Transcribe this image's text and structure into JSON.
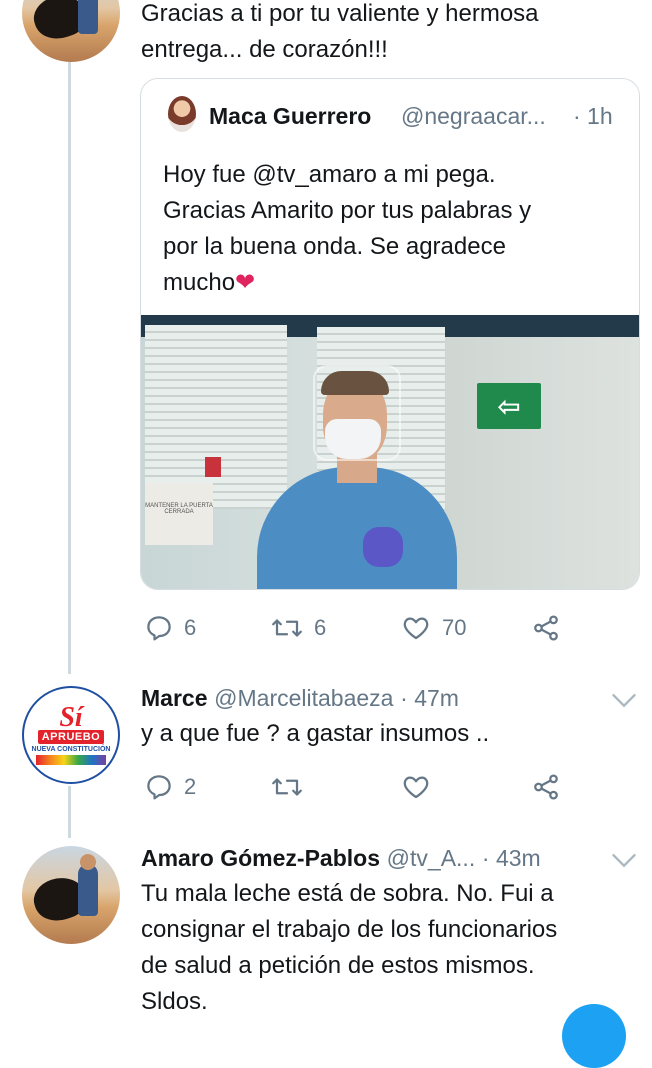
{
  "reply1": {
    "text_lines": [
      "Gracias a ti por tu valiente y hermosa",
      "entrega... de corazón!!!"
    ]
  },
  "quoted_tweet": {
    "name": "Maca Guerrero",
    "handle": "@negraacar...",
    "time": "· 1h",
    "text_lines": [
      "Hoy fue @tv_amaro a mi pega.",
      "Gracias Amarito por tus palabras y",
      "por la buena onda. Se agradece",
      "mucho"
    ],
    "emoji": "❤",
    "photo": {
      "exit_sign": "⇦",
      "door_note": "MANTENER LA PUERTA CERRADA"
    }
  },
  "tweet1_actions": {
    "replies": "6",
    "retweets": "6",
    "likes": "70"
  },
  "tweet2": {
    "name": "Marce",
    "handle": "@Marcelitabaeza",
    "time": "· 47m",
    "text": "y a que fue ?  a gastar insumos ..",
    "avatar": {
      "si": "Sí",
      "word": "APRUEBO",
      "sub": "NUEVA CONSTITUCIÓN"
    },
    "actions": {
      "replies": "2",
      "retweets": "",
      "likes": ""
    }
  },
  "tweet3": {
    "name": "Amaro Gómez-Pablos",
    "handle": "@tv_A...",
    "time": "· 43m",
    "text_lines": [
      "Tu mala leche está de sobra. No. Fui a",
      "consignar el trabajo de los funcionarios",
      "de salud a petición de estos mismos.",
      "Sldos."
    ]
  },
  "colors": {
    "text": "#14171a",
    "muted": "#657786",
    "border": "#d6dde2",
    "thread": "#cfd9de",
    "like": "#e0245e",
    "accent": "#1da1f2"
  },
  "icons": [
    "reply-icon",
    "retweet-icon",
    "like-icon",
    "share-icon",
    "chevron-down-icon"
  ]
}
